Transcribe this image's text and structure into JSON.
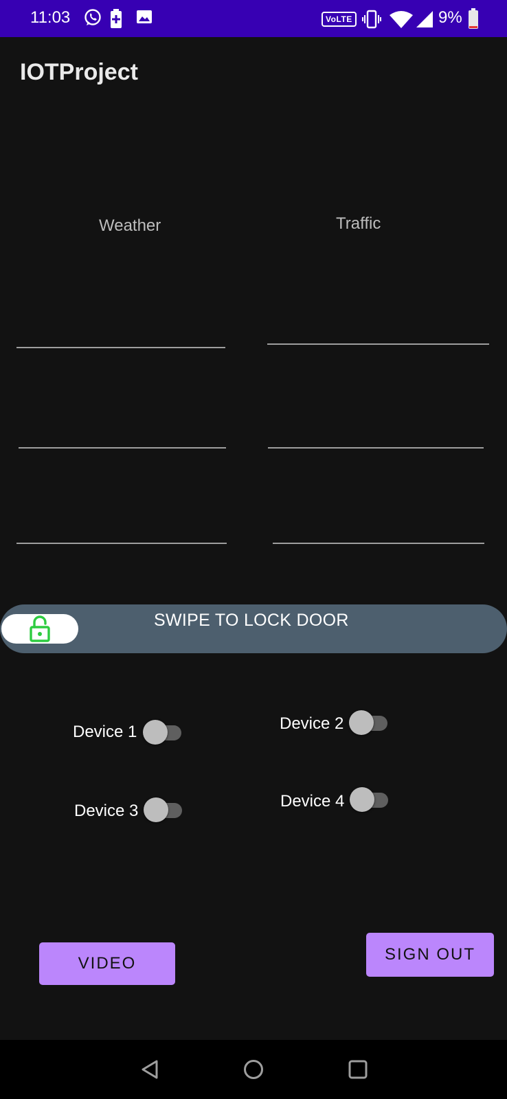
{
  "status_bar": {
    "time": "11:03",
    "volte": "VoLTE",
    "battery": "9%",
    "icons": [
      "whatsapp-icon",
      "battery-saver-icon",
      "gallery-icon",
      "vibrate-icon",
      "wifi-icon",
      "signal-icon",
      "battery-icon"
    ]
  },
  "app_bar": {
    "title": "IOTProject"
  },
  "columns": {
    "weather_label": "Weather",
    "traffic_label": "Traffic"
  },
  "swipe": {
    "label": "SWIPE TO LOCK DOOR",
    "icon": "unlock-icon",
    "icon_color": "#2ecc40"
  },
  "devices": [
    {
      "label": "Device 1",
      "on": false
    },
    {
      "label": "Device 2",
      "on": false
    },
    {
      "label": "Device 3",
      "on": false
    },
    {
      "label": "Device 4",
      "on": false
    }
  ],
  "buttons": {
    "video": "VIDEO",
    "sign_out": "SIGN OUT"
  },
  "nav_bar": {
    "icons": [
      "back-icon",
      "home-icon",
      "recents-icon"
    ]
  },
  "colors": {
    "status_bar": "#3700b3",
    "background": "#121212",
    "accent": "#bb86fc",
    "swipe_track": "#4d5f6e"
  }
}
